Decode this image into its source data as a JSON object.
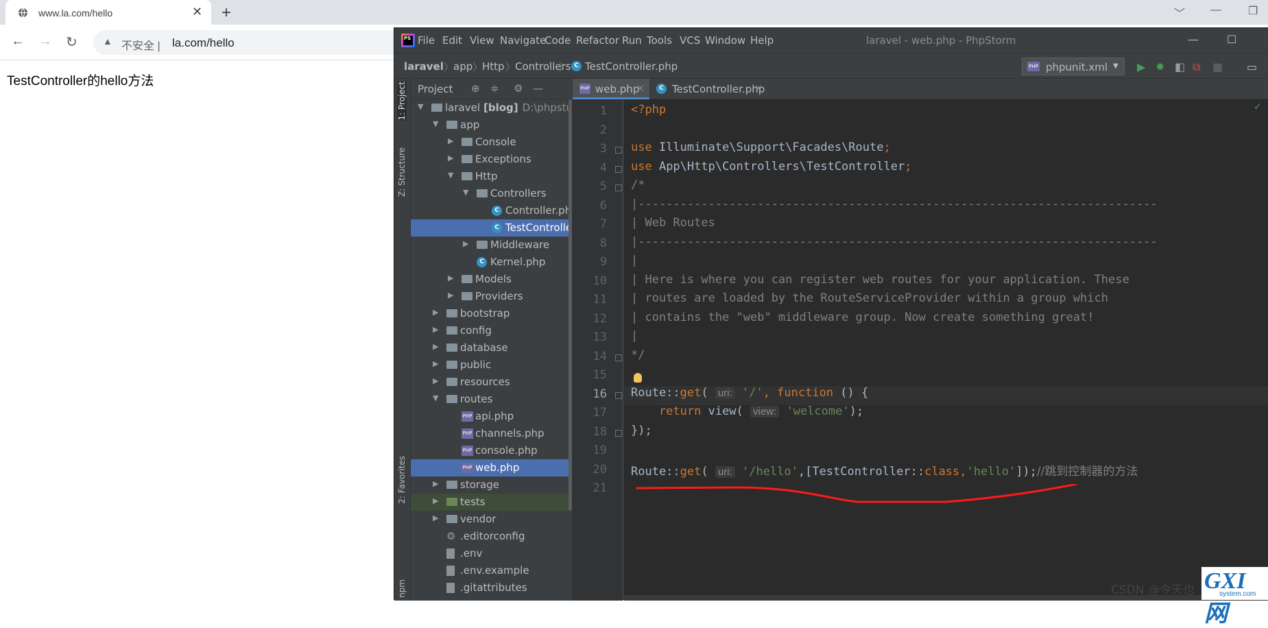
{
  "browser": {
    "tab_title": "www.la.com/hello",
    "tab_close": "✕",
    "new_tab": "+",
    "window_controls": [
      "﹀",
      "—",
      "❐"
    ],
    "back": "←",
    "forward": "→",
    "reload": "↻",
    "insecure_label": "不安全 |",
    "url": "la.com/hello",
    "page_text": "TestController的hello方法"
  },
  "ide": {
    "window_title": "laravel - web.php - PhpStorm",
    "logo": "PS",
    "menu": [
      "File",
      "Edit",
      "View",
      "Navigate",
      "Code",
      "Refactor",
      "Run",
      "Tools",
      "VCS",
      "Window",
      "Help"
    ],
    "window_controls": [
      "—",
      "☐"
    ],
    "breadcrumb": [
      "laravel",
      "app",
      "Http",
      "Controllers",
      "TestController.php"
    ],
    "run_config": "phpunit.xml",
    "side_tabs": [
      "1: Project",
      "Z: Structure",
      "2: Favorites",
      "npm"
    ],
    "project_panel_title": "Project",
    "tree": [
      {
        "label": "laravel",
        "bold": "[blog]",
        "extra": "D:\\phpstudy",
        "depth": 0,
        "type": "folder",
        "arrow": "▼"
      },
      {
        "label": "app",
        "depth": 1,
        "type": "folder",
        "arrow": "▼"
      },
      {
        "label": "Console",
        "depth": 2,
        "type": "folder",
        "arrow": "▶"
      },
      {
        "label": "Exceptions",
        "depth": 2,
        "type": "folder",
        "arrow": "▶"
      },
      {
        "label": "Http",
        "depth": 2,
        "type": "folder",
        "arrow": "▼"
      },
      {
        "label": "Controllers",
        "depth": 3,
        "type": "folder",
        "arrow": "▼"
      },
      {
        "label": "Controller.php",
        "depth": 4,
        "type": "class"
      },
      {
        "label": "TestController.php",
        "depth": 4,
        "type": "class",
        "selected": true
      },
      {
        "label": "Middleware",
        "depth": 3,
        "type": "folder",
        "arrow": "▶"
      },
      {
        "label": "Kernel.php",
        "depth": 3,
        "type": "class"
      },
      {
        "label": "Models",
        "depth": 2,
        "type": "folder",
        "arrow": "▶"
      },
      {
        "label": "Providers",
        "depth": 2,
        "type": "folder",
        "arrow": "▶"
      },
      {
        "label": "bootstrap",
        "depth": 1,
        "type": "folder",
        "arrow": "▶"
      },
      {
        "label": "config",
        "depth": 1,
        "type": "folder",
        "arrow": "▶"
      },
      {
        "label": "database",
        "depth": 1,
        "type": "folder",
        "arrow": "▶"
      },
      {
        "label": "public",
        "depth": 1,
        "type": "folder",
        "arrow": "▶"
      },
      {
        "label": "resources",
        "depth": 1,
        "type": "folder",
        "arrow": "▶"
      },
      {
        "label": "routes",
        "depth": 1,
        "type": "folder",
        "arrow": "▼"
      },
      {
        "label": "api.php",
        "depth": 2,
        "type": "php"
      },
      {
        "label": "channels.php",
        "depth": 2,
        "type": "php"
      },
      {
        "label": "console.php",
        "depth": 2,
        "type": "php"
      },
      {
        "label": "web.php",
        "depth": 2,
        "type": "php",
        "selected": true
      },
      {
        "label": "storage",
        "depth": 1,
        "type": "folder",
        "arrow": "▶"
      },
      {
        "label": "tests",
        "depth": 1,
        "type": "folder-green",
        "arrow": "▶",
        "green": true
      },
      {
        "label": "vendor",
        "depth": 1,
        "type": "folder",
        "arrow": "▶"
      },
      {
        "label": ".editorconfig",
        "depth": 1,
        "type": "gear"
      },
      {
        "label": ".env",
        "depth": 1,
        "type": "file"
      },
      {
        "label": ".env.example",
        "depth": 1,
        "type": "file"
      },
      {
        "label": ".gitattributes",
        "depth": 1,
        "type": "file"
      }
    ],
    "editor_tabs": [
      {
        "label": "web.php",
        "active": true,
        "icon": "php"
      },
      {
        "label": "TestController.php",
        "active": false,
        "icon": "class"
      }
    ],
    "line_numbers": [
      "1",
      "2",
      "3",
      "4",
      "5",
      "6",
      "7",
      "8",
      "9",
      "10",
      "11",
      "12",
      "13",
      "14",
      "15",
      "16",
      "17",
      "18",
      "19",
      "20",
      "21"
    ],
    "current_line": "16",
    "code": {
      "l1": "<?php",
      "l3_kw": "use",
      "l3_rest": " Illuminate\\Support\\Facades\\Route",
      "l4_kw": "use",
      "l4_rest": " App\\Http\\Controllers\\TestController",
      "semicolon": ";",
      "l5": "/*",
      "l6": "|--------------------------------------------------------------------------",
      "l7": "| Web Routes",
      "l8": "|--------------------------------------------------------------------------",
      "l9": "|",
      "l10": "| Here is where you can register web routes for your application. These",
      "l11": "| routes are loaded by the RouteServiceProvider within a group which",
      "l12": "| contains the \"web\" middleware group. Now create something great!",
      "l13": "|",
      "l14": "*/",
      "route": "Route::",
      "get": "get",
      "paren_open": "(",
      "hint_uri": "uri:",
      "hint_view": "view:",
      "l16_str": "'/'",
      "comma": ",",
      "function": " function",
      "l16_tail": " () {",
      "l17_return": "    return",
      "l17_view": " view(",
      "l17_str": "'welcome'",
      "l17_end": ");",
      "l18": "});",
      "l20_str1": "'/hello'",
      "l20_mid": ",[TestController::",
      "l20_class": "class",
      "l20_str2": "'hello'",
      "l20_end": "]);",
      "l20_comment": "//跳到控制器的方法"
    }
  },
  "watermark": "CSDN @今天也",
  "gxi_logo": {
    "big": "GXI网",
    "sub": "system.com"
  },
  "colors": {
    "annotation": "#ff1a1a"
  }
}
